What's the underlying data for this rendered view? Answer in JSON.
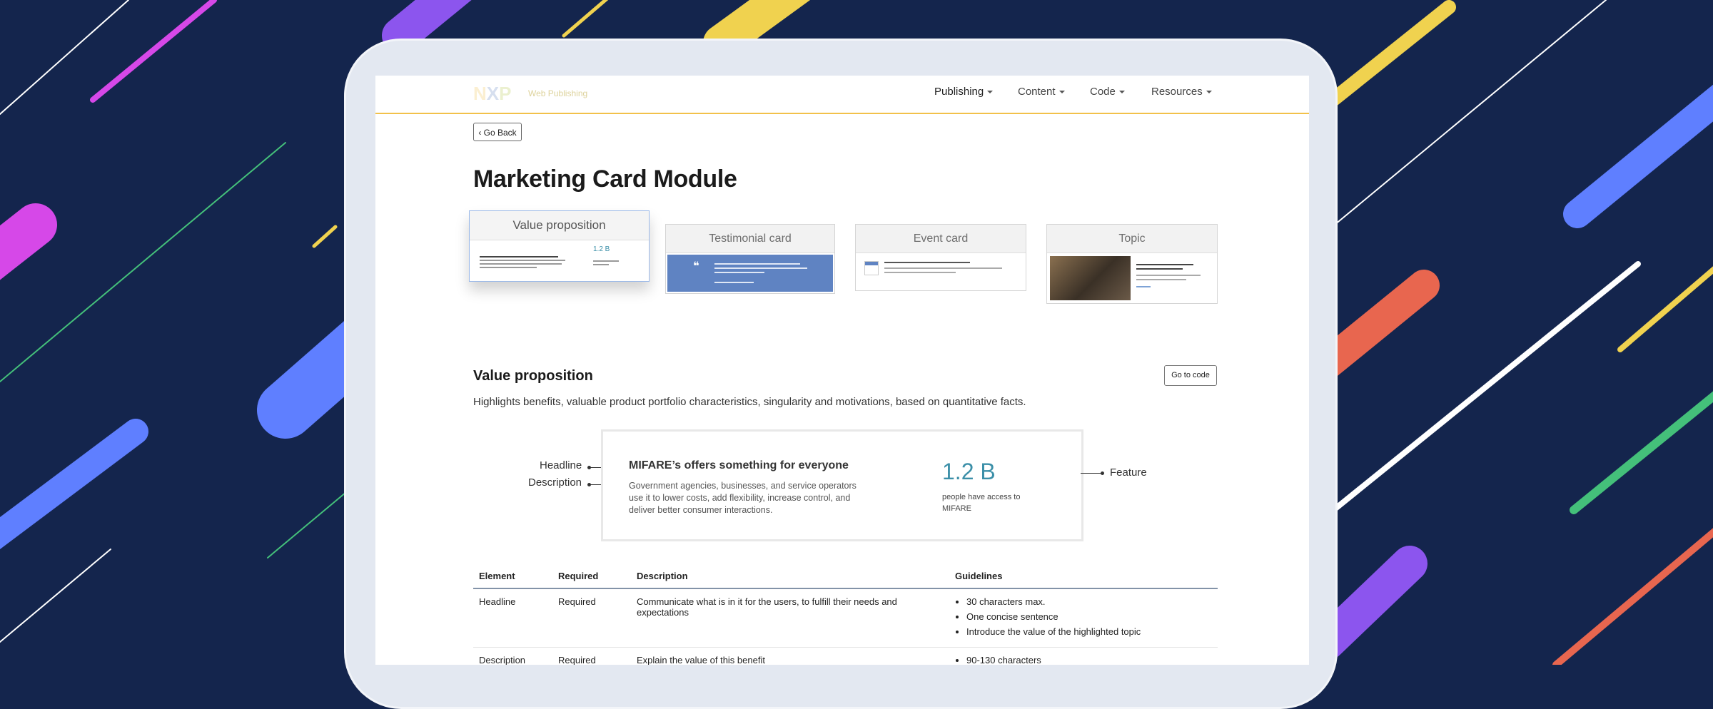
{
  "colors": {
    "background": "#14254d",
    "accent_yellow": "#f2c14a",
    "brand_blue": "#5f83c2",
    "feature_teal": "#3b8fa8"
  },
  "nav": {
    "brand_sub": "Web Publishing",
    "menus": [
      "Publishing",
      "Content",
      "Code",
      "Resources"
    ]
  },
  "go_back": "Go Back",
  "page_title": "Marketing Card Module",
  "cards": [
    {
      "label": "Value proposition"
    },
    {
      "label": "Testimonial card"
    },
    {
      "label": "Event card"
    },
    {
      "label": "Topic"
    }
  ],
  "section": {
    "title": "Value proposition",
    "go_to_code": "Go to code",
    "description": "Highlights benefits, valuable product portfolio characteristics, singularity and motivations, based on quantitative facts."
  },
  "example": {
    "headline": "MIFARE’s offers something for everyone",
    "description": "Government agencies, businesses, and service operators use it to lower costs, add flexibility, increase control, and deliver better consumer interactions.",
    "feature_value": "1.2 B",
    "feature_caption": "people have access to MIFARE",
    "callouts": {
      "headline": "Headline",
      "description": "Description",
      "feature": "Feature"
    }
  },
  "table": {
    "headers": [
      "Element",
      "Required",
      "Description",
      "Guidelines"
    ],
    "rows": [
      {
        "element": "Headline",
        "required": "Required",
        "description": "Communicate what is in it for the users, to fulfill their needs and expectations",
        "guidelines": [
          "30 characters max.",
          "One concise sentence",
          "Introduce the value of the highlighted topic"
        ]
      },
      {
        "element": "Description",
        "required": "Required",
        "description": "Explain the value of this benefit",
        "guidelines": [
          "90-130 characters"
        ]
      }
    ]
  }
}
